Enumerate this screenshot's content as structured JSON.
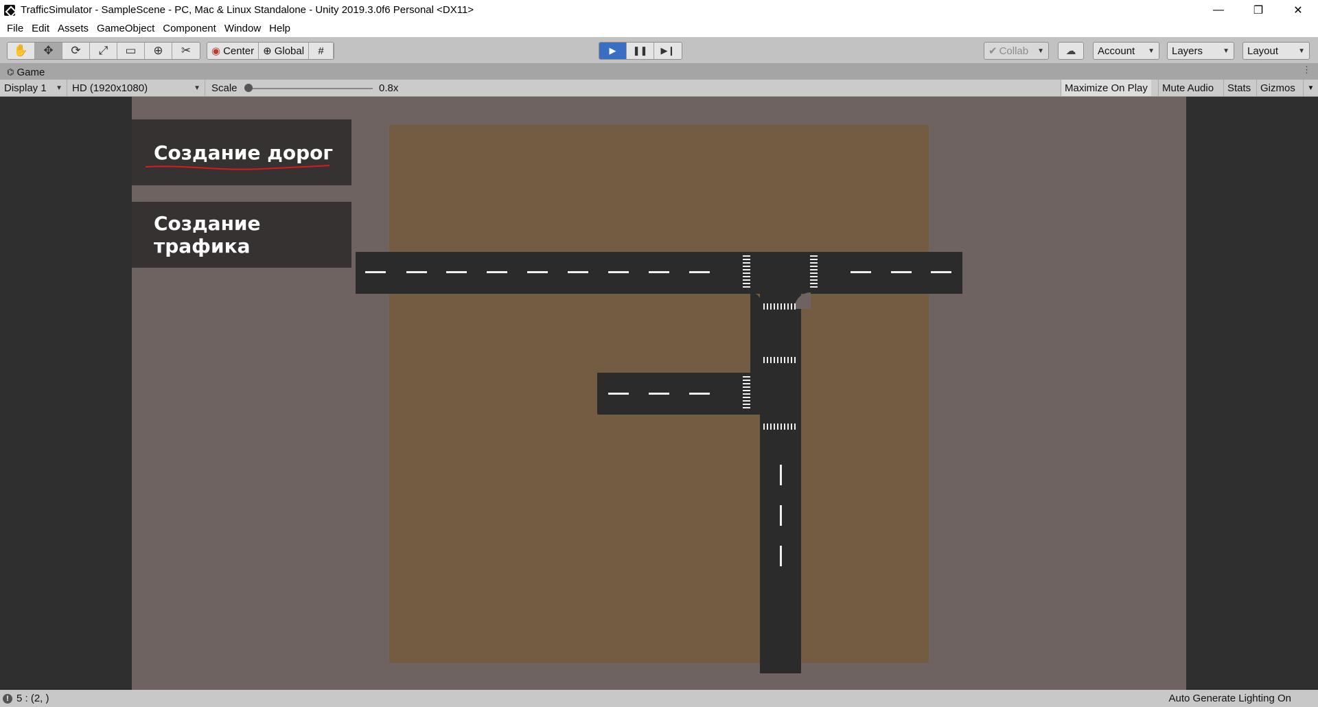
{
  "window": {
    "title": "TrafficSimulator - SampleScene - PC, Mac & Linux Standalone - Unity 2019.3.0f6 Personal <DX11>",
    "controls": {
      "minimize": "—",
      "restore": "❐",
      "close": "✕"
    }
  },
  "menubar": [
    "File",
    "Edit",
    "Assets",
    "GameObject",
    "Component",
    "Window",
    "Help"
  ],
  "toolbar": {
    "tools": [
      {
        "name": "hand-tool-icon",
        "glyph": "✋"
      },
      {
        "name": "move-tool-icon",
        "glyph": "✥"
      },
      {
        "name": "rotate-tool-icon",
        "glyph": "⟳"
      },
      {
        "name": "scale-tool-icon",
        "glyph": "⤢"
      },
      {
        "name": "rect-tool-icon",
        "glyph": "▭"
      },
      {
        "name": "transform-tool-icon",
        "glyph": "⊕"
      },
      {
        "name": "custom-tool-icon",
        "glyph": "✂"
      }
    ],
    "pivot_mode": "Center",
    "pivot_rotation": "Global",
    "snap_icon": "#",
    "play": {
      "play": "▶",
      "pause": "❚❚",
      "step": "▶❙"
    },
    "collab": "Collab",
    "account": "Account",
    "layers": "Layers",
    "layout": "Layout",
    "accent": "#3a6ec2"
  },
  "game_tab": {
    "label": "Game",
    "icon": "gamepad-icon"
  },
  "game_toolbar": {
    "display": "Display 1",
    "resolution": "HD (1920x1080)",
    "scale_label": "Scale",
    "scale_value": "0.8x",
    "maximize_on_play": "Maximize On Play",
    "mute_audio": "Mute Audio",
    "stats": "Stats",
    "gizmos": "Gizmos"
  },
  "game_ui": {
    "buttons": [
      "Создание дорог",
      "Создание трафика"
    ],
    "colors": {
      "panel": "#373232",
      "ground": "#745c43",
      "background": "#6e6360",
      "road": "#2b2b2b",
      "underline": "#d81c1c"
    }
  },
  "statusbar": {
    "message": "5 : (2, )",
    "lighting": "Auto Generate Lighting On"
  }
}
